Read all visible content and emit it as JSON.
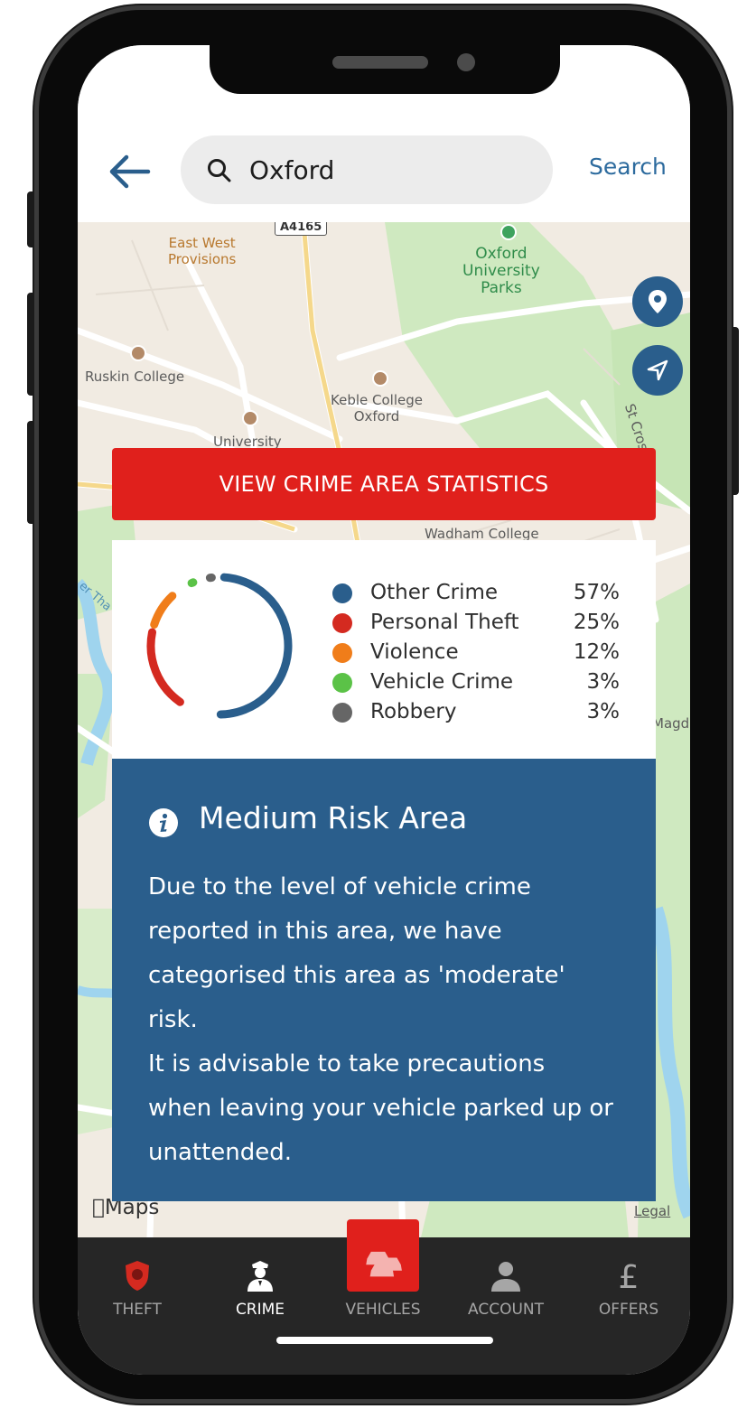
{
  "header": {
    "search_value": "Oxford",
    "search_link": "Search"
  },
  "map": {
    "labels": {
      "east_west": "East West\nProvisions",
      "road": "A4165",
      "parks": "Oxford\nUniversity\nParks",
      "ruskin": "Ruskin College",
      "keble": "Keble College\nOxford",
      "university": "University",
      "wadham": "Wadham College",
      "st_cross": "St Cros",
      "magd": "Magda",
      "river": "er Tha"
    },
    "maps_logo": "Maps",
    "legal": "Legal"
  },
  "stats": {
    "button_label": "VIEW CRIME AREA STATISTICS",
    "legend": [
      {
        "name": "Other Crime",
        "value": "57%",
        "color": "#2a5e8c"
      },
      {
        "name": "Personal Theft",
        "value": "25%",
        "color": "#d42a20"
      },
      {
        "name": "Violence",
        "value": "12%",
        "color": "#f07d1a"
      },
      {
        "name": "Vehicle Crime",
        "value": "3%",
        "color": "#5bc247"
      },
      {
        "name": "Robbery",
        "value": "3%",
        "color": "#666666"
      }
    ]
  },
  "risk": {
    "title": "Medium Risk Area",
    "text": "Due to the level of vehicle crime\nreported in this area, we have\ncategorised this area as 'moderate'\nrisk.\nIt is advisable to take precautions\nwhen leaving your vehicle parked up or\nunattended."
  },
  "tabs": [
    {
      "label": "THEFT",
      "icon": "shield-badge-icon"
    },
    {
      "label": "CRIME",
      "icon": "police-officer-icon"
    },
    {
      "label": "VEHICLES",
      "icon": "cars-icon"
    },
    {
      "label": "ACCOUNT",
      "icon": "person-icon"
    },
    {
      "label": "OFFERS",
      "icon": "pound-sign-icon"
    }
  ],
  "colors": {
    "accent_red": "#e0201c",
    "brand_blue": "#2a5e8c"
  }
}
